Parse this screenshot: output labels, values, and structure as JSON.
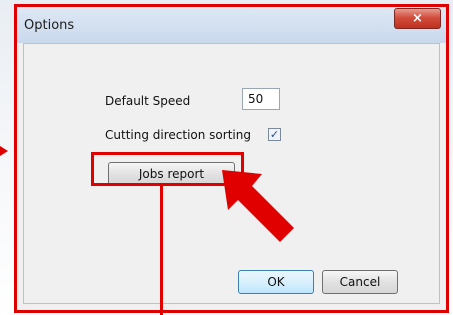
{
  "window": {
    "title": "Options",
    "close_icon": "×"
  },
  "form": {
    "speed_label": "Default Speed",
    "speed_value": "50",
    "sorting_label": "Cutting direction sorting",
    "sorting_checked": true,
    "check_glyph": "✓"
  },
  "buttons": {
    "jobs_report": "Jobs report",
    "ok": "OK",
    "cancel": "Cancel"
  },
  "colors": {
    "annotation": "#e00000",
    "close_button": "#c0301f"
  },
  "icons": {
    "close": "close-icon",
    "arrow": "pointer-arrow-icon"
  }
}
